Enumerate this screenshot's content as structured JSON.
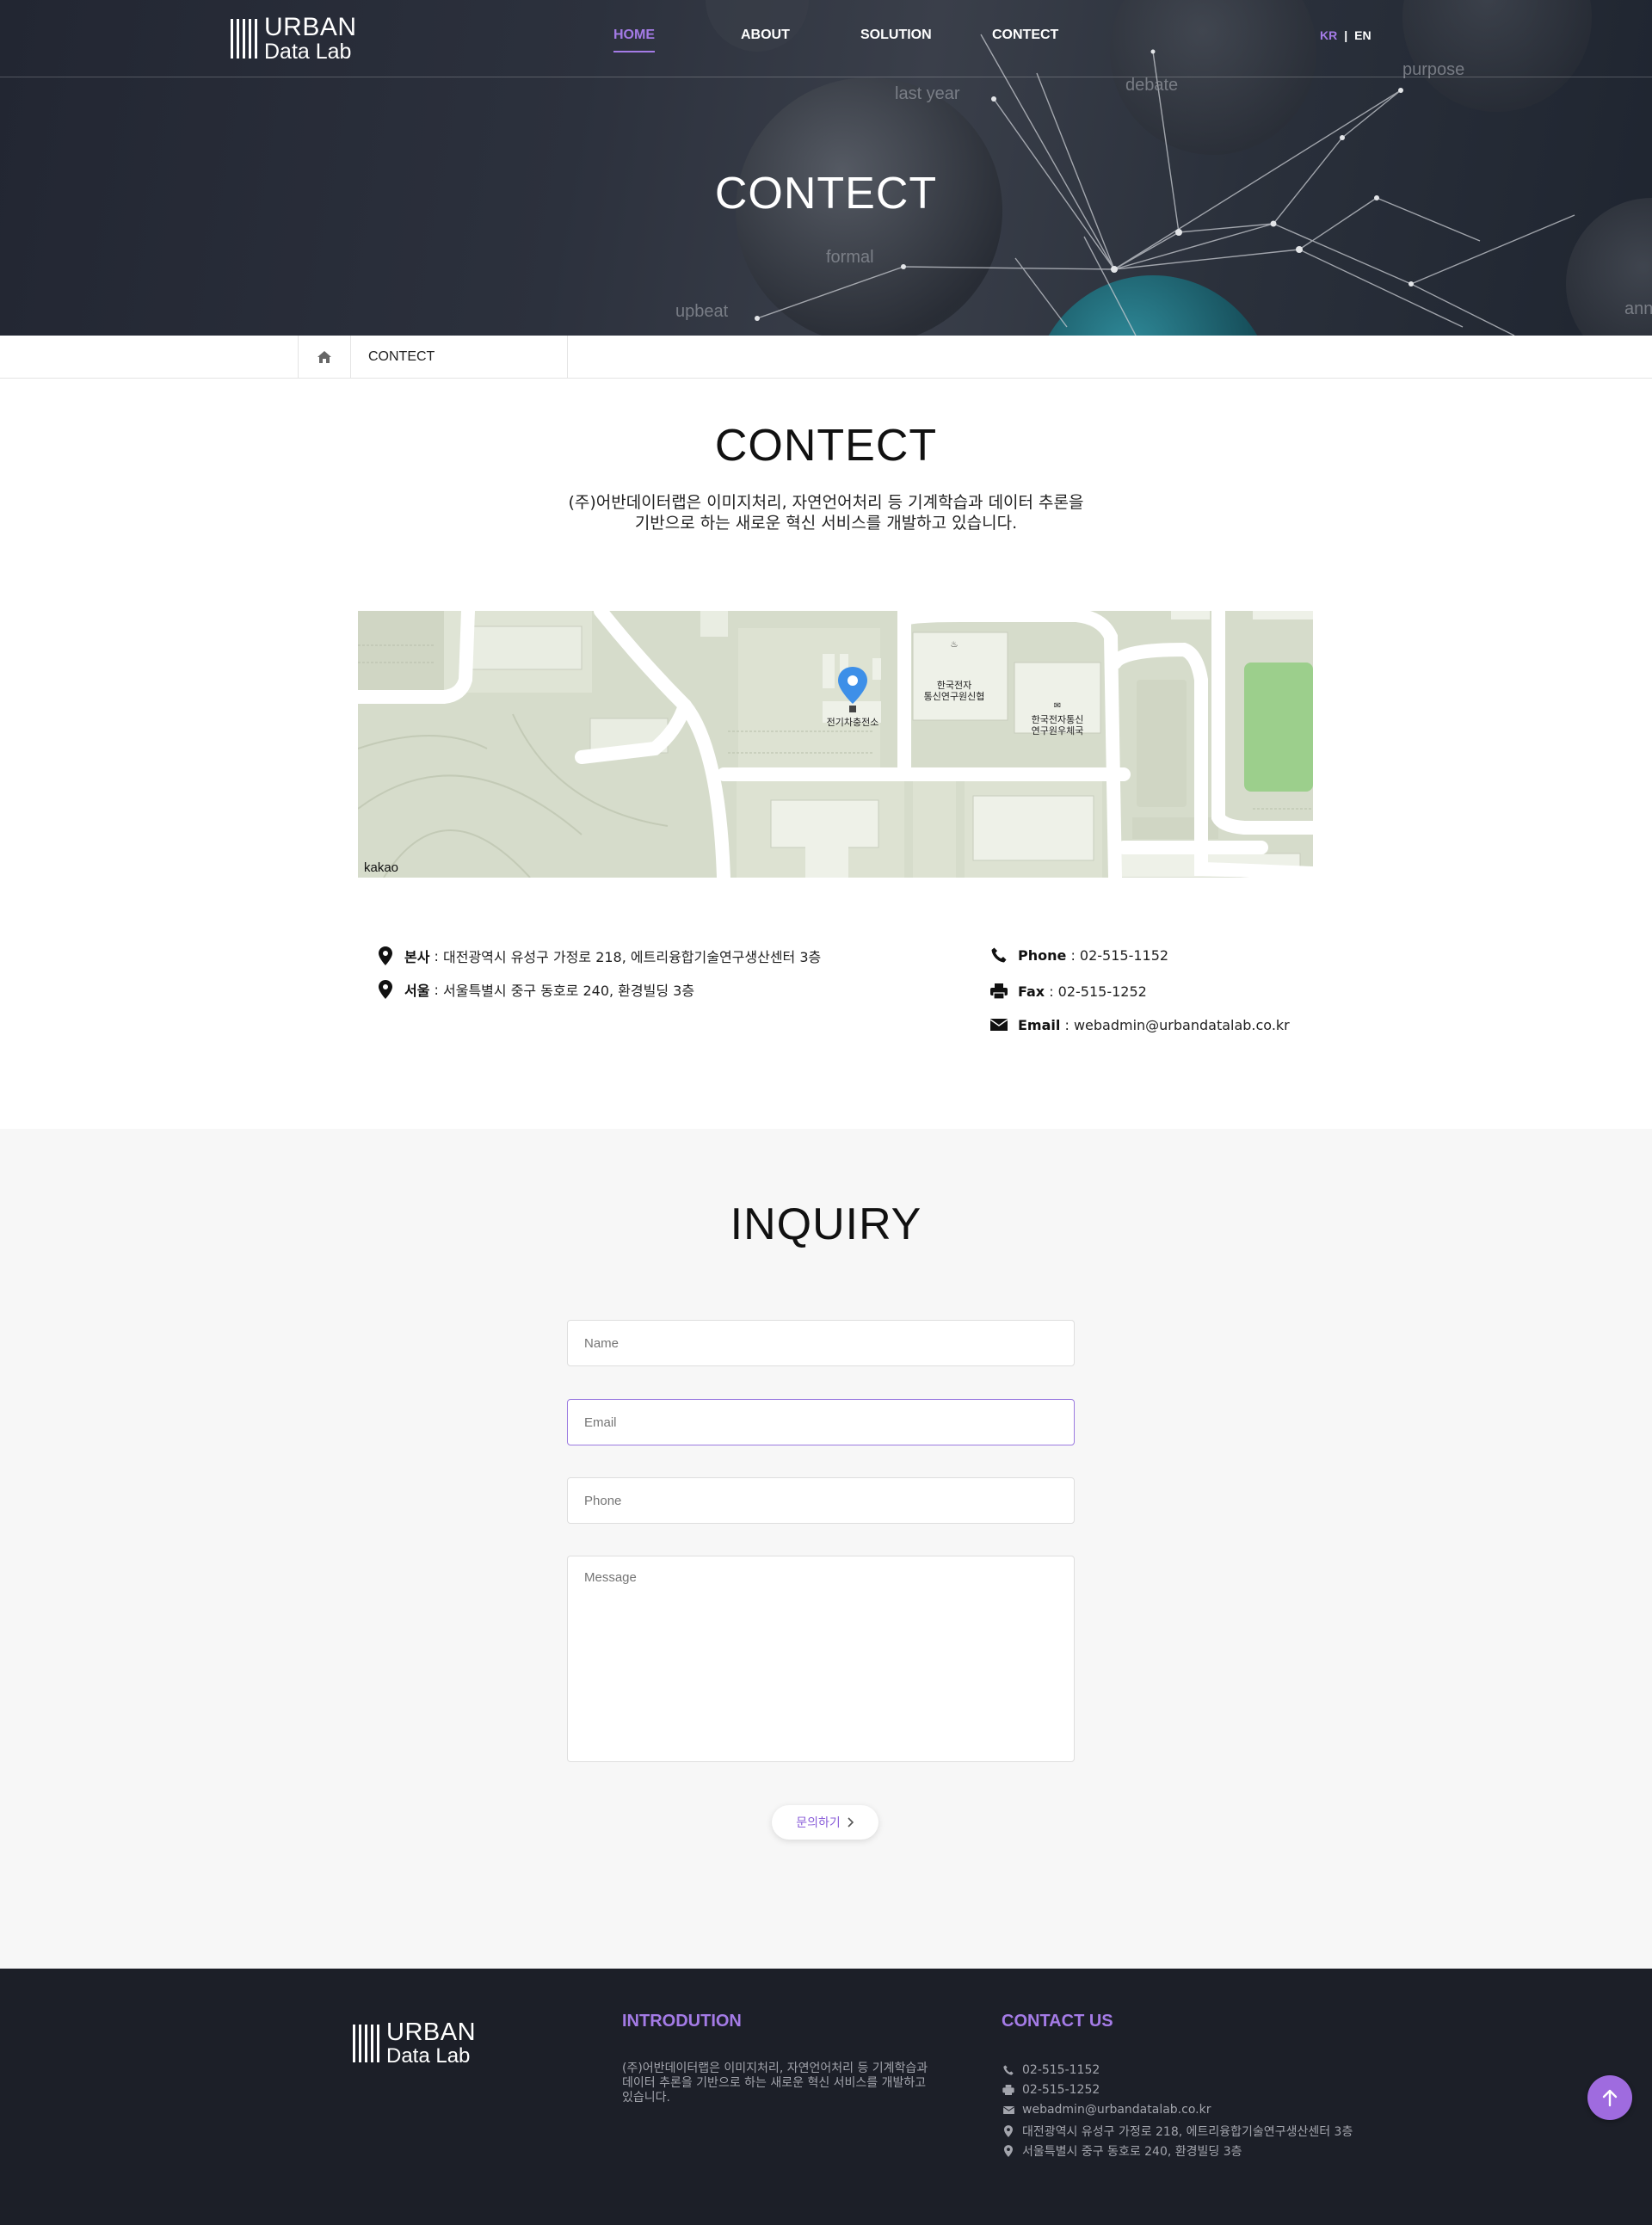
{
  "header": {
    "logo_line1": "URBAN",
    "logo_line2": "Data Lab",
    "menu": [
      {
        "label": "HOME"
      },
      {
        "label": "ABOUT"
      },
      {
        "label": "SOLUTION"
      },
      {
        "label": "CONTECT"
      }
    ],
    "lang_kr": "KR",
    "lang_sep": "|",
    "lang_en": "EN"
  },
  "hero": {
    "title": "CONTECT",
    "bg_words": [
      "last year",
      "debate",
      "purpose",
      "formal",
      "upbeat",
      "ann"
    ]
  },
  "breadcrumb": {
    "current": "CONTECT"
  },
  "contact": {
    "title": "CONTECT",
    "intro_line1": "(주)어반데이터랩은 이미지처리, 자연언어처리 등 기계학습과 데이터 추론을",
    "intro_line2": "기반으로 하는 새로운 혁신 서비스를 개발하고 있습니다.",
    "map": {
      "attribution": "kakao",
      "places": [
        {
          "label": "전기차충전소"
        },
        {
          "label_line1": "한국전자",
          "label_line2": "통신연구원신협"
        },
        {
          "label_line1": "한국전자통신",
          "label_line2": "연구원우체국"
        }
      ]
    },
    "addresses": [
      {
        "label": "본사",
        "sep": " : ",
        "value": "대전광역시 유성구 가정로 218, 에트리융합기술연구생산센터 3층"
      },
      {
        "label": "서울",
        "sep": " : ",
        "value": "서울특별시 중구 동호로 240, 환경빌딩 3층"
      }
    ],
    "phone": {
      "label": "Phone",
      "sep": " : ",
      "value": "02-515-1152"
    },
    "fax": {
      "label": "Fax",
      "sep": " : ",
      "value": "02-515-1252"
    },
    "email": {
      "label": "Email",
      "sep": " : ",
      "value": "webadmin@urbandatalab.co.kr"
    }
  },
  "inquiry": {
    "title": "INQUIRY",
    "name_placeholder": "Name",
    "email_placeholder": "Email",
    "phone_placeholder": "Phone",
    "message_placeholder": "Message",
    "submit_label": "문의하기"
  },
  "footer": {
    "logo_line1": "URBAN",
    "logo_line2": "Data Lab",
    "intro_title": "INTRODUTION",
    "intro_text": "(주)어반데이터랩은 이미지처리, 자연언어처리 등 기계학습과 데이터 추론을 기반으로 하는 새로운 혁신 서비스를 개발하고 있습니다.",
    "contact_title": "CONTACT US",
    "phone": "02-515-1152",
    "fax": "02-515-1252",
    "email": "webadmin@urbandatalab.co.kr",
    "address1": "대전광역시 유성구 가정로 218, 에트리융합기술연구생산센터 3층",
    "address2": "서울특별시 중구 동호로 240, 환경빌딩 3층"
  },
  "colors": {
    "accent": "#a47be6",
    "hero_bg": "#2c313d",
    "footer_bg": "#1c1f28",
    "inquiry_bg": "#f7f7f7",
    "map_green": "#9ccf8c"
  },
  "icons": [
    "home-icon",
    "map-pin-icon",
    "phone-icon",
    "fax-icon",
    "mail-icon",
    "chevron-right-icon",
    "arrow-up-icon"
  ]
}
